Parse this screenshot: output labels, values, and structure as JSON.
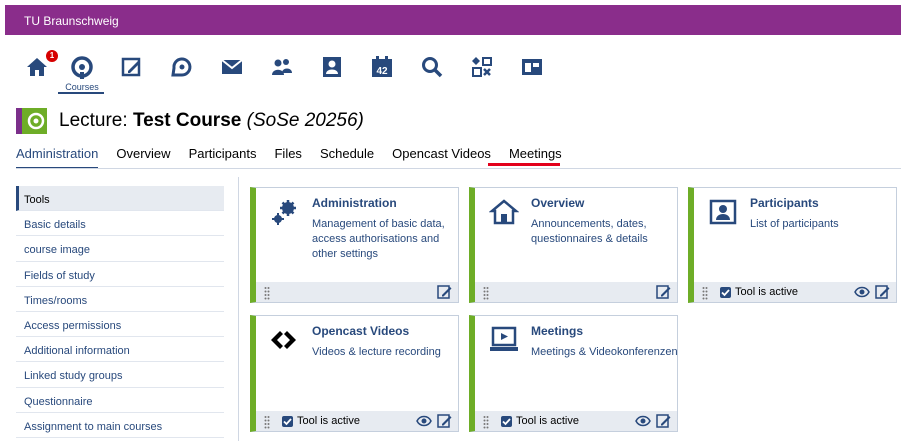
{
  "header": {
    "title": "TU Braunschweig"
  },
  "nav": {
    "badge_count": "1",
    "courses_label": "Courses",
    "icons": [
      "home-icon",
      "courses-icon",
      "contents-icon",
      "messages-forum-icon",
      "mail-icon",
      "community-icon",
      "profile-icon",
      "calendar-icon",
      "search-icon",
      "tools-icon",
      "admin-icon"
    ],
    "calendar_day": "42"
  },
  "course": {
    "type_label": "Lecture:",
    "name": "Test Course",
    "semester": "(SoSe 20256)"
  },
  "tabs": [
    {
      "label": "Administration",
      "active": true
    },
    {
      "label": "Overview"
    },
    {
      "label": "Participants"
    },
    {
      "label": "Files"
    },
    {
      "label": "Schedule"
    },
    {
      "label": "Opencast Videos"
    },
    {
      "label": "Meetings"
    }
  ],
  "sidebar": {
    "items": [
      {
        "label": "Tools",
        "active": true
      },
      {
        "label": "Basic details"
      },
      {
        "label": "course image"
      },
      {
        "label": "Fields of study"
      },
      {
        "label": "Times/rooms"
      },
      {
        "label": "Access permissions"
      },
      {
        "label": "Additional information"
      },
      {
        "label": "Linked study groups"
      },
      {
        "label": "Questionnaire"
      },
      {
        "label": "Assignment to main courses"
      }
    ]
  },
  "cards": [
    {
      "title": "Administration",
      "desc": "Management of basic data, access authorisations and other settings",
      "active_label": ""
    },
    {
      "title": "Overview",
      "desc": "Announcements, dates, questionnaires & details",
      "active_label": ""
    },
    {
      "title": "Participants",
      "desc": "List of participants",
      "active_label": "Tool is active"
    },
    {
      "title": "Opencast Videos",
      "desc": "Videos & lecture recording",
      "active_label": "Tool is active"
    },
    {
      "title": "Meetings",
      "desc": "Meetings & Videokonferenzen",
      "active_label": "Tool is active"
    }
  ],
  "colors": {
    "brand": "#8a2d8b",
    "accent": "#28497c",
    "green": "#6ead27",
    "highlight": "#e3001b"
  }
}
